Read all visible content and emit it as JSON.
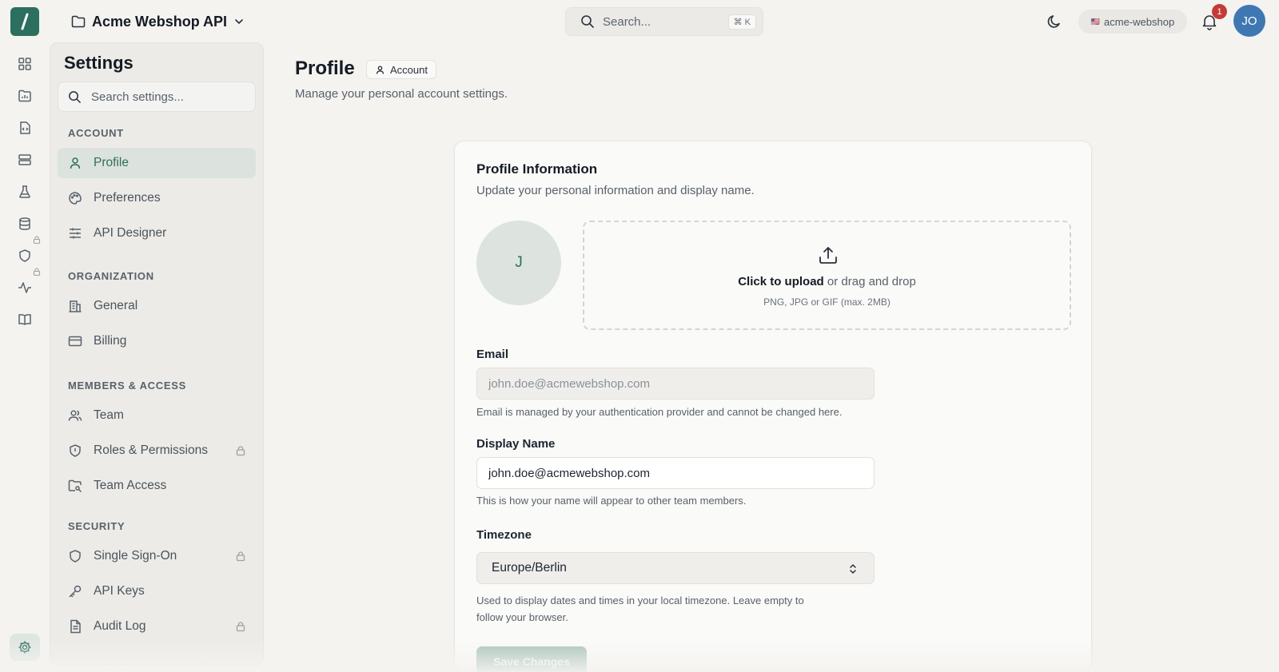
{
  "topbar": {
    "project_name": "Acme Webshop API",
    "search_placeholder": "Search...",
    "search_shortcut": "⌘ K",
    "org_flag": "🇺🇸",
    "org_name": "acme-webshop",
    "notification_count": "1",
    "user_initials": "JO"
  },
  "rail": {
    "icons": [
      "dashboard-icon",
      "folder-chart-icon",
      "code-file-icon",
      "server-icon",
      "flask-icon",
      "database-icon",
      "shield-icon",
      "activity-icon",
      "book-icon",
      "gear-icon"
    ]
  },
  "settings": {
    "title": "Settings",
    "search_placeholder": "Search settings...",
    "sections": {
      "account": {
        "heading": "ACCOUNT",
        "items": [
          {
            "label": "Profile",
            "icon": "user-icon",
            "active": true
          },
          {
            "label": "Preferences",
            "icon": "palette-icon"
          },
          {
            "label": "API Designer",
            "icon": "sliders-icon"
          }
        ]
      },
      "organization": {
        "heading": "ORGANIZATION",
        "items": [
          {
            "label": "General",
            "icon": "building-icon"
          },
          {
            "label": "Billing",
            "icon": "credit-card-icon"
          }
        ]
      },
      "members": {
        "heading": "MEMBERS & ACCESS",
        "items": [
          {
            "label": "Team",
            "icon": "users-icon"
          },
          {
            "label": "Roles & Permissions",
            "icon": "shield-icon",
            "locked": true
          },
          {
            "label": "Team Access",
            "icon": "folder-key-icon"
          }
        ]
      },
      "security": {
        "heading": "SECURITY",
        "items": [
          {
            "label": "Single Sign-On",
            "icon": "shield-icon",
            "locked": true
          },
          {
            "label": "API Keys",
            "icon": "key-icon"
          },
          {
            "label": "Audit Log",
            "icon": "file-text-icon",
            "locked": true
          }
        ]
      }
    }
  },
  "page": {
    "title": "Profile",
    "badge": "Account",
    "subtitle": "Manage your personal account settings."
  },
  "profile_card": {
    "title": "Profile Information",
    "subtitle": "Update your personal information and display name.",
    "avatar_initial": "J",
    "upload": {
      "action": "Click to upload",
      "rest": " or drag and drop",
      "hint": "PNG, JPG or GIF (max. 2MB)"
    },
    "email": {
      "label": "Email",
      "value": "john.doe@acmewebshop.com",
      "help": "Email is managed by your authentication provider and cannot be changed here."
    },
    "display_name": {
      "label": "Display Name",
      "value": "john.doe@acmewebshop.com",
      "help": "This is how your name will appear to other team members."
    },
    "timezone": {
      "label": "Timezone",
      "value": "Europe/Berlin",
      "help_line1": "Used to display dates and times in your local timezone. Leave empty to",
      "help_line2": "follow your browser."
    },
    "save_label": "Save Changes"
  },
  "colors": {
    "accent": "#2d6f5e",
    "active_bg": "#dce3de",
    "badge_red": "#c33b37",
    "avatar_blue": "#3f77b3"
  }
}
